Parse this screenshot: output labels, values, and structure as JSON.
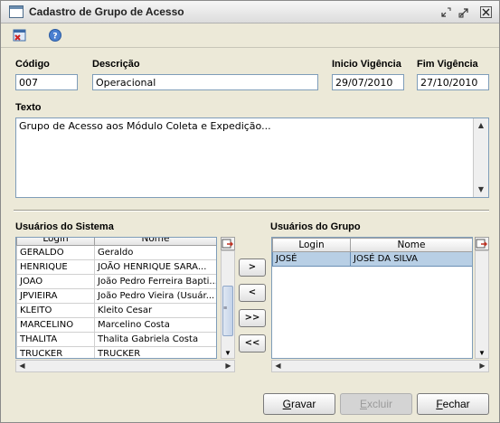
{
  "window": {
    "title": "Cadastro de Grupo de Acesso"
  },
  "toolbar": {
    "icons": [
      "delete-record-icon",
      "help-icon"
    ]
  },
  "form": {
    "codigo": {
      "label": "Código",
      "value": "007"
    },
    "descricao": {
      "label": "Descrição",
      "value": "Operacional"
    },
    "inicio": {
      "label": "Inicio Vigência",
      "value": "29/07/2010"
    },
    "fim": {
      "label": "Fim Vigência",
      "value": "27/10/2010"
    },
    "texto": {
      "label": "Texto",
      "value": "Grupo de Acesso aos Módulo Coleta e Expedição..."
    }
  },
  "sistema": {
    "label": "Usuários do Sistema",
    "columns": [
      "Login",
      "Nome"
    ],
    "rows": [
      [
        "GERALDO",
        "Geraldo"
      ],
      [
        "HENRIQUE",
        "JOÃO HENRIQUE SARA..."
      ],
      [
        "JOAO",
        "João Pedro Ferreira Bapti..."
      ],
      [
        "JPVIEIRA",
        "João Pedro Vieira (Usuár..."
      ],
      [
        "KLEITO",
        "Kleito Cesar"
      ],
      [
        "MARCELINO",
        "Marcelino Costa"
      ],
      [
        "THALITA",
        "Thalita Gabriela Costa"
      ],
      [
        "TRUCKER",
        "TRUCKER"
      ]
    ]
  },
  "grupo": {
    "label": "Usuários do Grupo",
    "columns": [
      "Login",
      "Nome"
    ],
    "rows": [
      [
        "JOSÉ",
        "JOSÉ DA SILVA"
      ]
    ]
  },
  "move_buttons": [
    ">",
    "<",
    ">>",
    "<<"
  ],
  "buttons": {
    "gravar": {
      "first": "G",
      "rest": "ravar"
    },
    "excluir": {
      "first": "E",
      "rest": "xcluir"
    },
    "fechar": {
      "first": "F",
      "rest": "echar"
    }
  }
}
